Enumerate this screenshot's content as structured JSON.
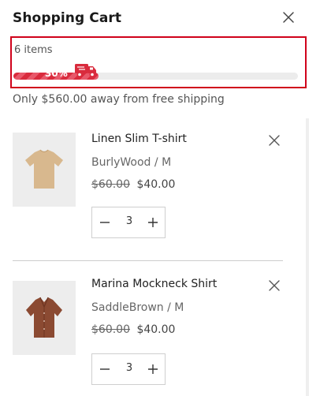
{
  "cart": {
    "title": "Shopping Cart",
    "items_count": "6 items",
    "progress_label": "30%",
    "progress_fraction": 0.3,
    "shipping_message": "Only $560.00 away from free shipping"
  },
  "items": [
    {
      "name": "Linen Slim T-shirt",
      "variant": "BurlyWood / M",
      "old_price": "$60.00",
      "price": "$40.00",
      "quantity": "3",
      "swatch": "#d8b88e"
    },
    {
      "name": "Marina Mockneck Shirt",
      "variant": "SaddleBrown / M",
      "old_price": "$60.00",
      "price": "$40.00",
      "quantity": "3",
      "swatch": "#8b4a32"
    }
  ],
  "colors": {
    "accent": "#d92b3d",
    "highlight_border": "#d0021b"
  },
  "icons": {
    "close": "close-icon",
    "remove": "remove-icon",
    "minus": "minus-icon",
    "plus": "plus-icon",
    "truck": "truck-icon"
  }
}
